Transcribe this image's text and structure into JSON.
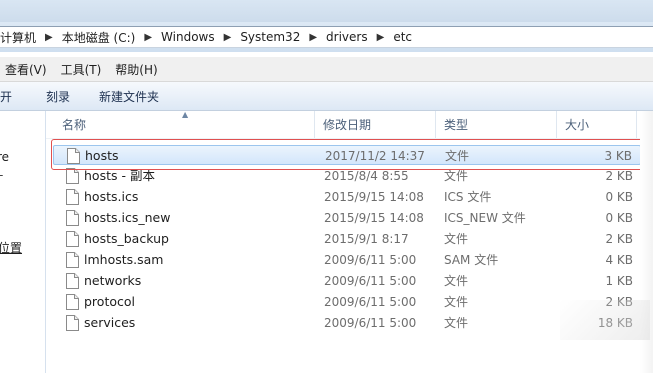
{
  "breadcrumb": {
    "items": [
      "计算机",
      "本地磁盘 (C:)",
      "Windows",
      "System32",
      "drivers",
      "etc"
    ]
  },
  "menubar": {
    "items": [
      "查看(V)",
      "工具(T)",
      "帮助(H)"
    ]
  },
  "toolbar": {
    "open_label": "打开",
    "burn_label": "刻录",
    "new_folder_label": "新建文件夹"
  },
  "nav_pane": {
    "item_re": "re",
    "item_location": "位置"
  },
  "columns": {
    "name": "名称",
    "modified": "修改日期",
    "type": "类型",
    "size": "大小"
  },
  "files": [
    {
      "name": "hosts",
      "modified": "2017/11/2 14:37",
      "type": "文件",
      "size": "3 KB",
      "selected": true
    },
    {
      "name": "hosts - 副本",
      "modified": "2015/8/4 8:55",
      "type": "文件",
      "size": "2 KB"
    },
    {
      "name": "hosts.ics",
      "modified": "2015/9/15 14:08",
      "type": "ICS 文件",
      "size": "0 KB"
    },
    {
      "name": "hosts.ics_new",
      "modified": "2015/9/15 14:08",
      "type": "ICS_NEW 文件",
      "size": "0 KB"
    },
    {
      "name": "hosts_backup",
      "modified": "2015/9/1 8:17",
      "type": "文件",
      "size": "2 KB"
    },
    {
      "name": "lmhosts.sam",
      "modified": "2009/6/11 5:00",
      "type": "SAM 文件",
      "size": "4 KB"
    },
    {
      "name": "networks",
      "modified": "2009/6/11 5:00",
      "type": "文件",
      "size": "1 KB"
    },
    {
      "name": "protocol",
      "modified": "2009/6/11 5:00",
      "type": "文件",
      "size": "2 KB"
    },
    {
      "name": "services",
      "modified": "2009/6/11 5:00",
      "type": "文件",
      "size": "18 KB"
    }
  ],
  "colors": {
    "selection_border": "#9cc5ee",
    "highlight_box": "#e05050",
    "header_text": "#4c607a"
  }
}
